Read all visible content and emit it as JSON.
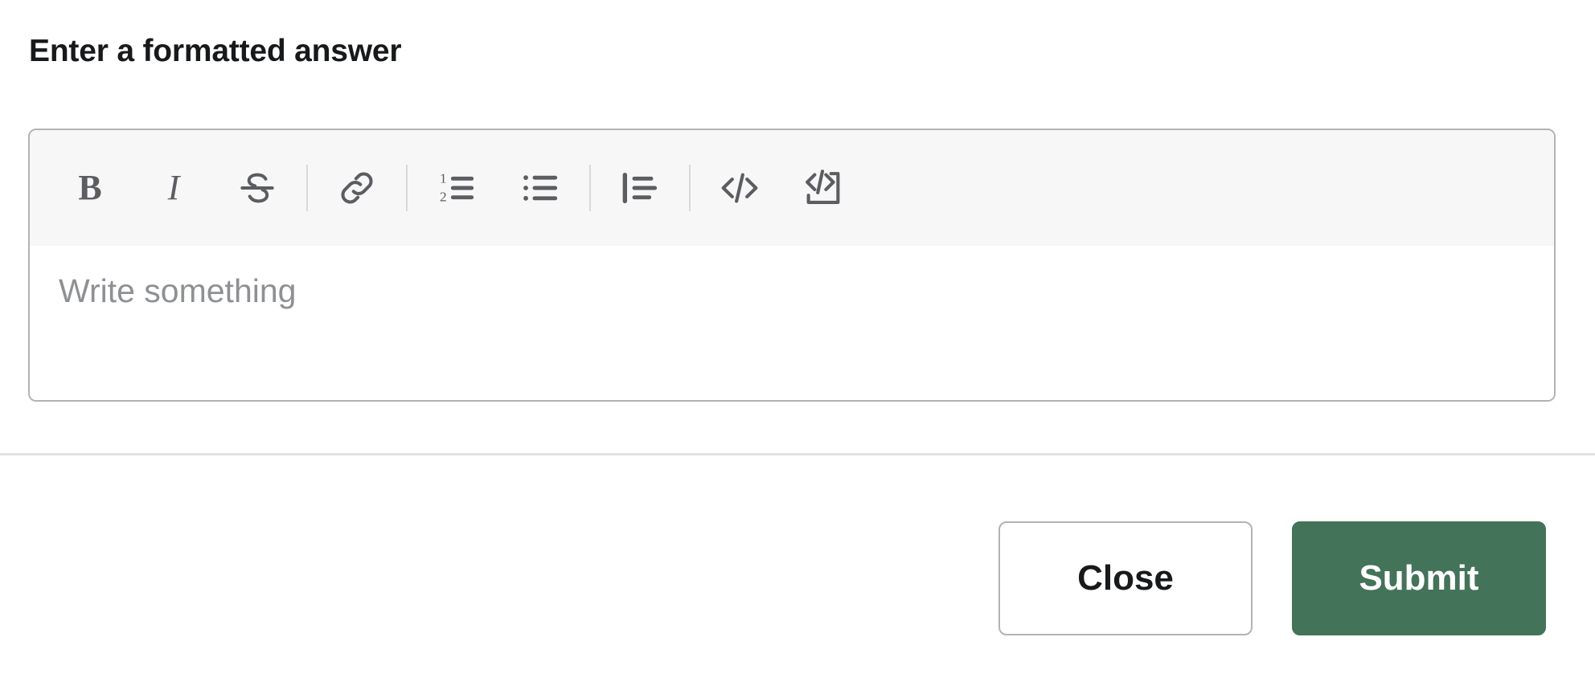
{
  "dialog": {
    "title": "Enter a formatted answer"
  },
  "editor": {
    "placeholder": "Write something",
    "value": "",
    "toolbar": {
      "items": [
        {
          "name": "bold",
          "icon": "bold-icon",
          "label": "B",
          "type": "text"
        },
        {
          "name": "italic",
          "icon": "italic-icon",
          "label": "I",
          "type": "text"
        },
        {
          "name": "strikethrough",
          "icon": "strikethrough-icon",
          "label": "S",
          "type": "text"
        },
        {
          "name": "divider-1",
          "icon": "toolbar-divider",
          "label": "",
          "type": "divider"
        },
        {
          "name": "link",
          "icon": "link-icon",
          "label": "",
          "type": "svg"
        },
        {
          "name": "divider-2",
          "icon": "toolbar-divider",
          "label": "",
          "type": "divider"
        },
        {
          "name": "ordered-list",
          "icon": "ordered-list-icon",
          "label": "",
          "type": "svg"
        },
        {
          "name": "bullet-list",
          "icon": "bullet-list-icon",
          "label": "",
          "type": "svg"
        },
        {
          "name": "divider-3",
          "icon": "toolbar-divider",
          "label": "",
          "type": "divider"
        },
        {
          "name": "blockquote",
          "icon": "blockquote-icon",
          "label": "",
          "type": "svg"
        },
        {
          "name": "divider-4",
          "icon": "toolbar-divider",
          "label": "",
          "type": "divider"
        },
        {
          "name": "inline-code",
          "icon": "code-icon",
          "label": "",
          "type": "svg"
        },
        {
          "name": "code-block",
          "icon": "code-block-icon",
          "label": "",
          "type": "svg"
        }
      ]
    }
  },
  "footer": {
    "close_label": "Close",
    "submit_label": "Submit"
  },
  "colors": {
    "submit_background": "#437358",
    "border": "#b3b3b3",
    "toolbar_background": "#f7f7f7",
    "divider": "#e2e2e2",
    "icon": "#5b5d61",
    "placeholder_text": "#8e9094",
    "title_text": "#18191b"
  }
}
